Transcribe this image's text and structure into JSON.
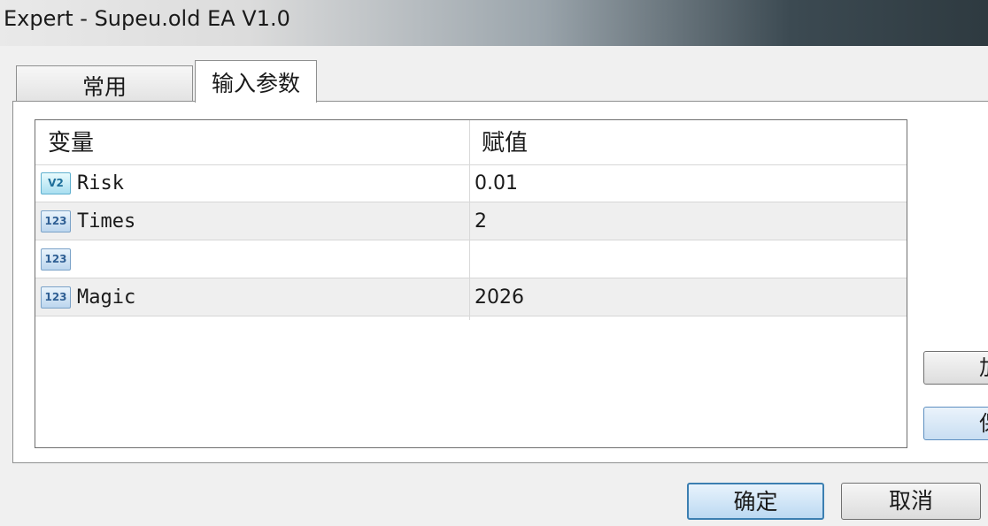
{
  "window": {
    "title": "Expert - Supeu.old EA V1.0"
  },
  "tabs": [
    {
      "label": "常用"
    },
    {
      "label": "输入参数",
      "active": true
    }
  ],
  "grid": {
    "columns": {
      "variable": "变量",
      "value": "赋值"
    },
    "rows": [
      {
        "icon": "double-type-icon",
        "icon_text": "V2",
        "name": "Risk",
        "value": "0.01"
      },
      {
        "icon": "integer-type-icon",
        "icon_text": "123",
        "name": "Times",
        "value": "2"
      },
      {
        "icon": "integer-type-icon",
        "icon_text": "123",
        "name": "",
        "value": ""
      },
      {
        "icon": "integer-type-icon",
        "icon_text": "123",
        "name": "Magic",
        "value": "2026"
      }
    ]
  },
  "side_buttons": {
    "load": "加",
    "save": "保"
  },
  "dialog_buttons": {
    "ok": "确定",
    "cancel": "取消"
  }
}
